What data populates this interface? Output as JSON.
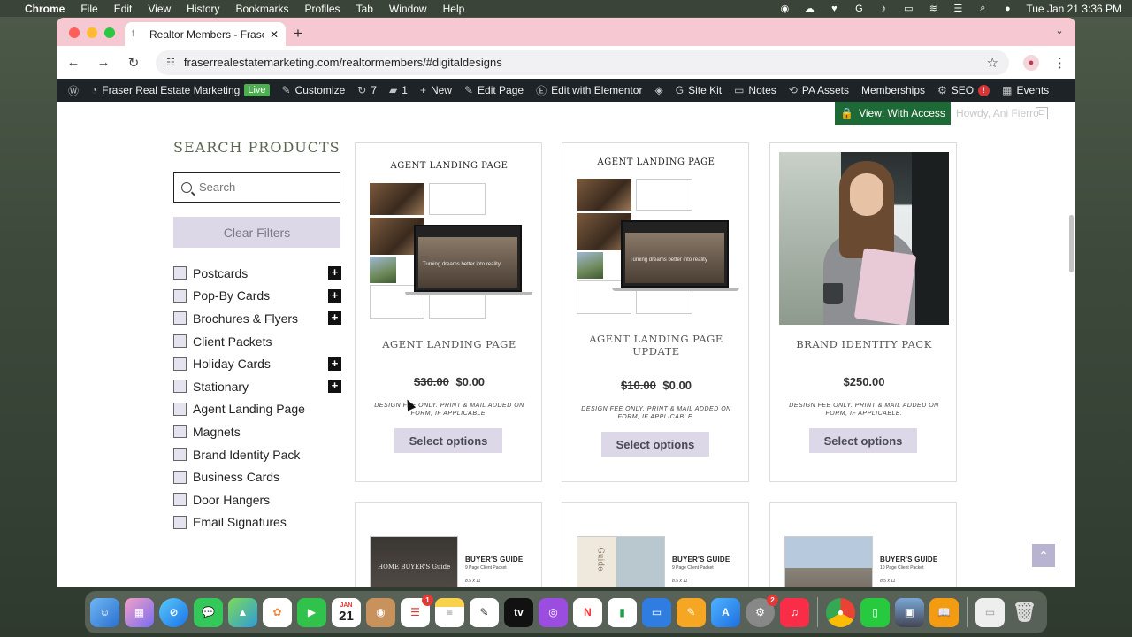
{
  "menubar": {
    "app_name": "Chrome",
    "menus": [
      "File",
      "Edit",
      "View",
      "History",
      "Bookmarks",
      "Profiles",
      "Tab",
      "Window",
      "Help"
    ],
    "datetime": "Tue Jan 21  3:36 PM"
  },
  "browser": {
    "tab_title": "Realtor Members - Fraser Re",
    "url": "fraserrealestatemarketing.com/realtormembers/#digitaldesigns"
  },
  "wp_admin": {
    "site_name": "Fraser Real Estate Marketing",
    "live_label": "Live",
    "customize": "Customize",
    "updates_count": "7",
    "comments_count": "1",
    "new": "New",
    "edit_page": "Edit Page",
    "elementor": "Edit with Elementor",
    "site_kit": "Site Kit",
    "notes": "Notes",
    "pa_assets": "PA Assets",
    "memberships": "Memberships",
    "seo": "SEO",
    "seo_badge": "!",
    "events": "Events"
  },
  "view_access": "View: With Access",
  "howdy": "Howdy, Ani Fierro",
  "sidebar": {
    "heading": "SEARCH PRODUCTS",
    "search_placeholder": "Search",
    "clear_filters": "Clear Filters",
    "categories": [
      {
        "label": "Postcards",
        "expandable": true
      },
      {
        "label": "Pop-By Cards",
        "expandable": true
      },
      {
        "label": "Brochures & Flyers",
        "expandable": true
      },
      {
        "label": "Client Packets",
        "expandable": false
      },
      {
        "label": "Holiday Cards",
        "expandable": true
      },
      {
        "label": "Stationary",
        "expandable": true
      },
      {
        "label": "Agent Landing Page",
        "expandable": false
      },
      {
        "label": "Magnets",
        "expandable": false
      },
      {
        "label": "Brand Identity Pack",
        "expandable": false
      },
      {
        "label": "Business Cards",
        "expandable": false
      },
      {
        "label": "Door Hangers",
        "expandable": false
      },
      {
        "label": "Email Signatures",
        "expandable": false
      }
    ]
  },
  "products": [
    {
      "image_heading": "AGENT LANDING PAGE",
      "screen_text": "Turning dreams better into reality",
      "title": "AGENT LANDING PAGE",
      "old_price": "$30.00",
      "price": "$0.00",
      "fee_note": "DESIGN FEE ONLY. PRINT & MAIL ADDED ON FORM, IF APPLICABLE.",
      "button": "Select options"
    },
    {
      "image_heading": "AGENT LANDING PAGE",
      "screen_text": "Turning dreams better into reality",
      "title": "AGENT LANDING PAGE UPDATE",
      "old_price": "$10.00",
      "price": "$0.00",
      "fee_note": "DESIGN FEE ONLY. PRINT & MAIL ADDED ON FORM, IF APPLICABLE.",
      "button": "Select options"
    },
    {
      "title": "BRAND IDENTITY PACK",
      "old_price": "",
      "price": "$250.00",
      "fee_note": "DESIGN FEE ONLY. PRINT & MAIL ADDED ON FORM, IF APPLICABLE.",
      "button": "Select options"
    }
  ],
  "guides": [
    {
      "cover_text": "HOME BUYER'S Guide",
      "title": "BUYER'S GUIDE",
      "sub": "9 Page Client Packet",
      "size": "8.5 x 11"
    },
    {
      "cover_text": "Guide",
      "title": "BUYER'S GUIDE",
      "sub": "9 Page Client Packet",
      "size": "8.5 x 11"
    },
    {
      "title": "BUYER'S GUIDE",
      "sub": "10 Page Client Packet",
      "size": "8.5 x 11"
    }
  ],
  "dock": {
    "calendar_month": "JAN",
    "calendar_day": "21",
    "reminders_badge": "1",
    "settings_badge": "2"
  }
}
